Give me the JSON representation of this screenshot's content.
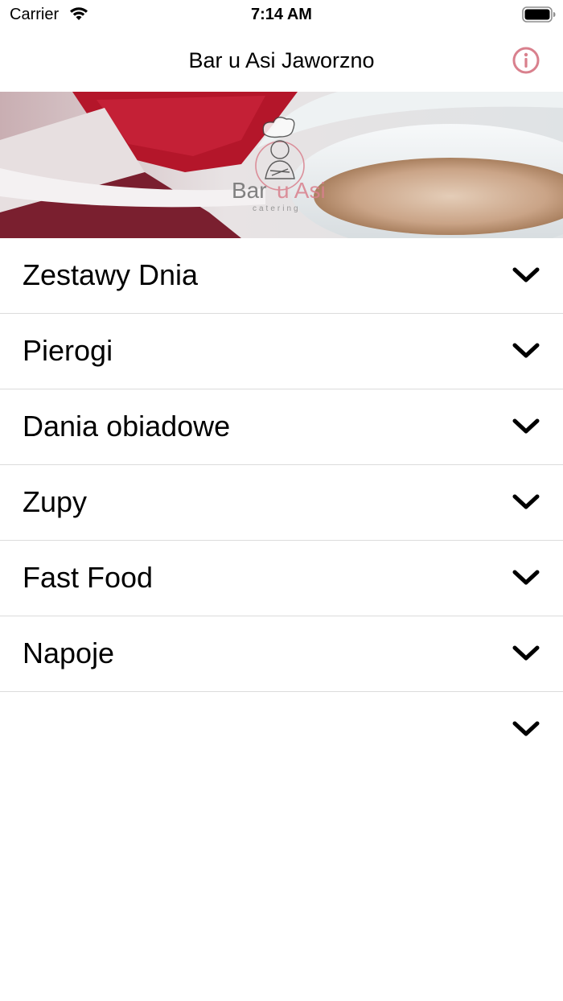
{
  "status_bar": {
    "carrier": "Carrier",
    "time": "7:14 AM",
    "wifi_icon": "wifi-icon",
    "battery_icon": "battery-full-icon"
  },
  "nav": {
    "title": "Bar u Asi Jaworzno",
    "info_icon": "info-circle-icon"
  },
  "hero": {
    "logo_text": "Bar u Asi",
    "logo_subtitle": "catering"
  },
  "colors": {
    "accent": "#d9808d",
    "separator": "#dcdcdc",
    "text": "#000000"
  },
  "menu": {
    "items": [
      {
        "label": "Zestawy Dnia",
        "icon": "chevron-down-icon"
      },
      {
        "label": "Pierogi",
        "icon": "chevron-down-icon"
      },
      {
        "label": "Dania obiadowe",
        "icon": "chevron-down-icon"
      },
      {
        "label": "Zupy",
        "icon": "chevron-down-icon"
      },
      {
        "label": "Fast Food",
        "icon": "chevron-down-icon"
      },
      {
        "label": "Napoje",
        "icon": "chevron-down-icon"
      },
      {
        "label": "",
        "icon": "chevron-down-icon"
      }
    ]
  }
}
